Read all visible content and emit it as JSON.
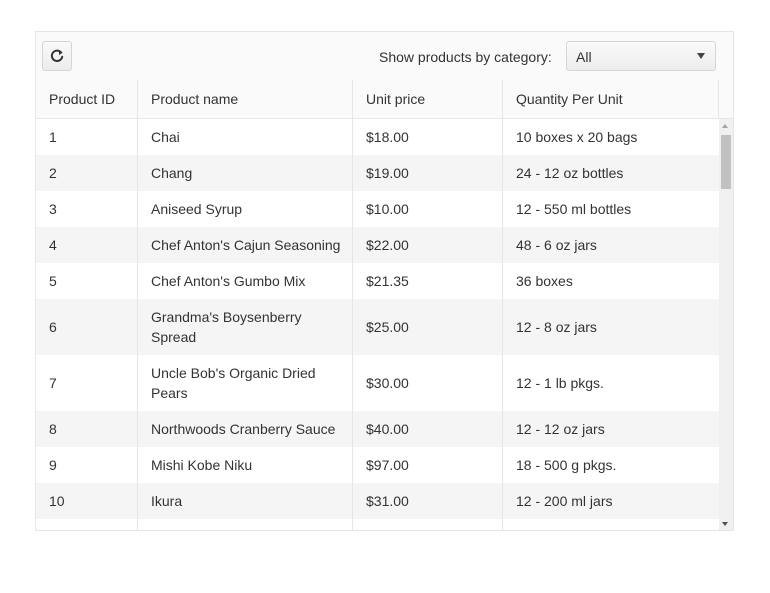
{
  "toolbar": {
    "refresh_icon": "refresh-icon",
    "category_label": "Show products by category:",
    "category_selected": "All"
  },
  "columns": [
    "Product ID",
    "Product name",
    "Unit price",
    "Quantity Per Unit"
  ],
  "rows": [
    {
      "id": "1",
      "name": "Chai",
      "price": "$18.00",
      "qty": "10 boxes x 20 bags"
    },
    {
      "id": "2",
      "name": "Chang",
      "price": "$19.00",
      "qty": "24 - 12 oz bottles"
    },
    {
      "id": "3",
      "name": "Aniseed Syrup",
      "price": "$10.00",
      "qty": "12 - 550 ml bottles"
    },
    {
      "id": "4",
      "name": "Chef Anton's Cajun Seasoning",
      "price": "$22.00",
      "qty": "48 - 6 oz jars"
    },
    {
      "id": "5",
      "name": "Chef Anton's Gumbo Mix",
      "price": "$21.35",
      "qty": "36 boxes"
    },
    {
      "id": "6",
      "name_lines": [
        "Grandma's Boysenberry",
        "Spread"
      ],
      "price": "$25.00",
      "qty": "12 - 8 oz jars"
    },
    {
      "id": "7",
      "name_lines": [
        "Uncle Bob's Organic Dried",
        "Pears"
      ],
      "price": "$30.00",
      "qty": "12 - 1 lb pkgs."
    },
    {
      "id": "8",
      "name": "Northwoods Cranberry Sauce",
      "price": "$40.00",
      "qty": "12 - 12 oz jars"
    },
    {
      "id": "9",
      "name": "Mishi Kobe Niku",
      "price": "$97.00",
      "qty": "18 - 500 g pkgs."
    },
    {
      "id": "10",
      "name": "Ikura",
      "price": "$31.00",
      "qty": "12 - 200 ml jars"
    }
  ],
  "colors": {
    "row_alt": "#f5f5f5",
    "border": "#e6e6e6",
    "text": "#333333"
  }
}
